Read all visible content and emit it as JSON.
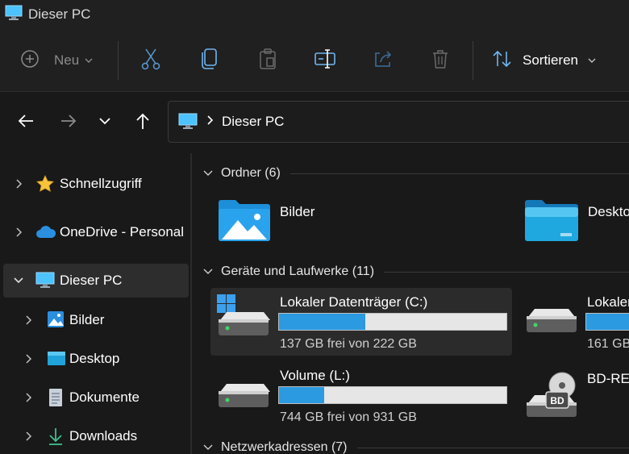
{
  "window": {
    "title": "Dieser PC"
  },
  "toolbar": {
    "new_label": "Neu",
    "sort_label": "Sortieren"
  },
  "address": {
    "crumb": "Dieser PC"
  },
  "sidebar": {
    "items": [
      {
        "label": "Schnellzugriff",
        "icon": "star-icon"
      },
      {
        "label": "OneDrive - Personal",
        "icon": "cloud-icon"
      },
      {
        "label": "Dieser PC",
        "icon": "computer-icon"
      },
      {
        "label": "Bilder",
        "icon": "pictures-icon"
      },
      {
        "label": "Desktop",
        "icon": "desktop-icon"
      },
      {
        "label": "Dokumente",
        "icon": "documents-icon"
      },
      {
        "label": "Downloads",
        "icon": "download-icon"
      }
    ]
  },
  "groups": {
    "folders": {
      "label": "Ordner (6)",
      "items": [
        "Bilder",
        "Desktop"
      ]
    },
    "drives": {
      "label": "Geräte und Laufwerke (11)",
      "items": [
        {
          "name": "Lokaler Datenträger (C:)",
          "free": "137 GB frei von 222 GB",
          "used_fraction": 0.38
        },
        {
          "name": "Lokaler",
          "free": "161 GB",
          "used_fraction": 0.5
        },
        {
          "name": "Volume (L:)",
          "free": "744 GB frei von 931 GB",
          "used_fraction": 0.2
        },
        {
          "name": "BD-RE",
          "free": ""
        }
      ]
    },
    "network": {
      "label": "Netzwerkadressen (7)"
    }
  },
  "colors": {
    "accent": "#2b9ae0",
    "folder": "#1d8fd8"
  }
}
